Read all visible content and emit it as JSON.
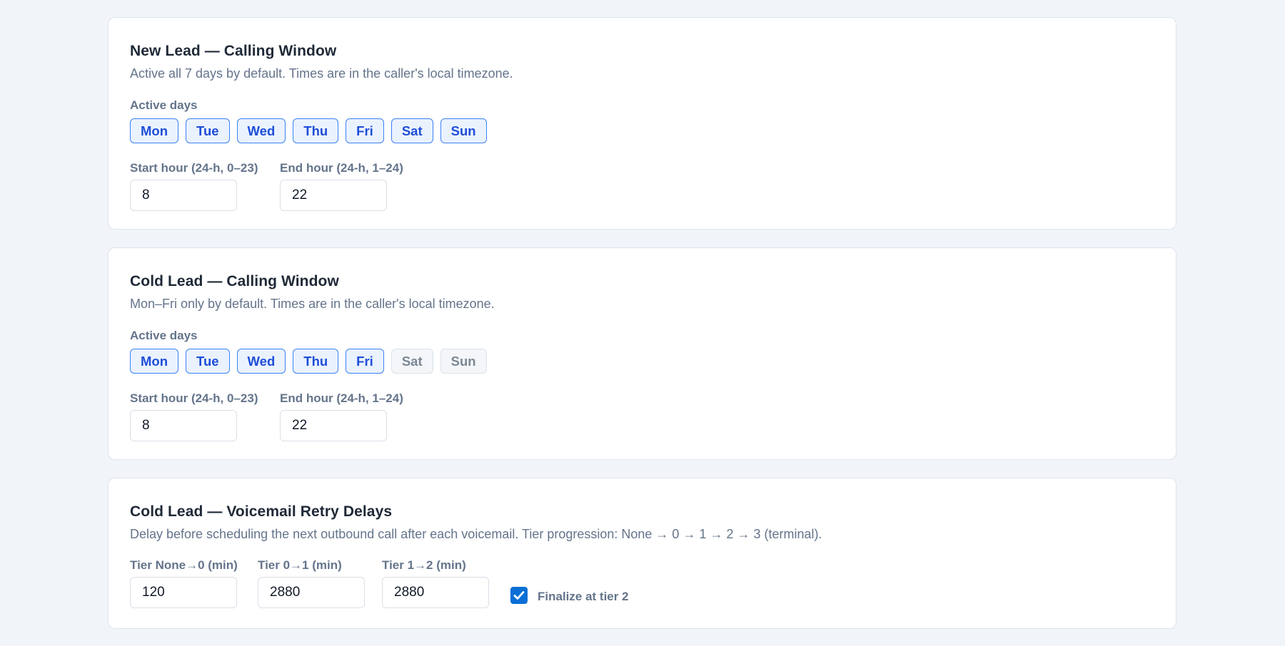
{
  "new_lead_window": {
    "title": "New Lead — Calling Window",
    "description": "Active all 7 days by default. Times are in the caller's local timezone.",
    "active_days_label": "Active days",
    "days": [
      {
        "label": "Mon",
        "active": true
      },
      {
        "label": "Tue",
        "active": true
      },
      {
        "label": "Wed",
        "active": true
      },
      {
        "label": "Thu",
        "active": true
      },
      {
        "label": "Fri",
        "active": true
      },
      {
        "label": "Sat",
        "active": true
      },
      {
        "label": "Sun",
        "active": true
      }
    ],
    "start_hour_label": "Start hour (24-h, 0–23)",
    "start_hour_value": "8",
    "end_hour_label": "End hour (24-h, 1–24)",
    "end_hour_value": "22"
  },
  "cold_lead_window": {
    "title": "Cold Lead — Calling Window",
    "description": "Mon–Fri only by default. Times are in the caller's local timezone.",
    "active_days_label": "Active days",
    "days": [
      {
        "label": "Mon",
        "active": true
      },
      {
        "label": "Tue",
        "active": true
      },
      {
        "label": "Wed",
        "active": true
      },
      {
        "label": "Thu",
        "active": true
      },
      {
        "label": "Fri",
        "active": true
      },
      {
        "label": "Sat",
        "active": false
      },
      {
        "label": "Sun",
        "active": false
      }
    ],
    "start_hour_label": "Start hour (24-h, 0–23)",
    "start_hour_value": "8",
    "end_hour_label": "End hour (24-h, 1–24)",
    "end_hour_value": "22"
  },
  "cold_lead_voicemail": {
    "title": "Cold Lead — Voicemail Retry Delays",
    "description": "Delay before scheduling the next outbound call after each voicemail. Tier progression: None → 0 → 1 → 2 → 3 (terminal).",
    "tiers": [
      {
        "label": "Tier None→0 (min)",
        "value": "120"
      },
      {
        "label": "Tier 0→1 (min)",
        "value": "2880"
      },
      {
        "label": "Tier 1→2 (min)",
        "value": "2880"
      }
    ],
    "finalize_label": "Finalize at tier 2",
    "finalize_checked": true
  },
  "colors": {
    "page_bg": "#f1f4f8",
    "card_bg": "#ffffff",
    "active_day_border": "#3b82f6",
    "active_day_text": "#1d4ed8",
    "inactive_day_text": "#7b8794",
    "checkbox_fill": "#0b6fd6"
  }
}
